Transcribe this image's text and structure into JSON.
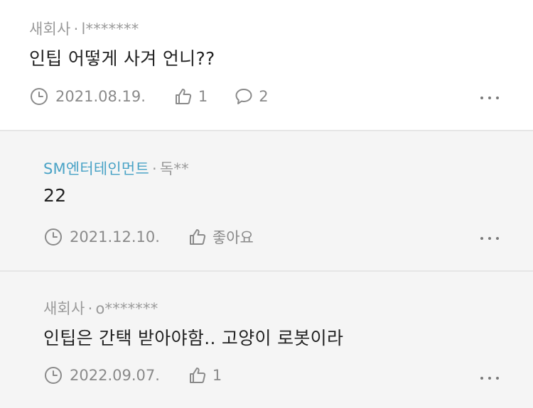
{
  "comments": [
    {
      "company": "새회사",
      "separator": "·",
      "user": "l*******",
      "text": "인팁 어떻게 사겨 언니??",
      "date": "2021.08.19.",
      "likes": "1",
      "replies": "2"
    },
    {
      "company": "SM엔터테인먼트",
      "separator": "·",
      "user": "독**",
      "text": "22",
      "date": "2021.12.10.",
      "likes": "좋아요"
    },
    {
      "company": "새회사",
      "separator": "·",
      "user": "o*******",
      "text": "인팁은 간택 받아야함.. 고양이 로봇이라",
      "date": "2022.09.07.",
      "likes": "1"
    }
  ],
  "colors": {
    "linked_company": "#4aa3c6",
    "muted_text": "#9a9a9a",
    "reply_background": "#f5f5f5"
  },
  "icons": {
    "date": "clock-icon",
    "like": "thumbs-up-icon",
    "reply": "speech-bubble-icon",
    "more": "more-dots-icon"
  }
}
